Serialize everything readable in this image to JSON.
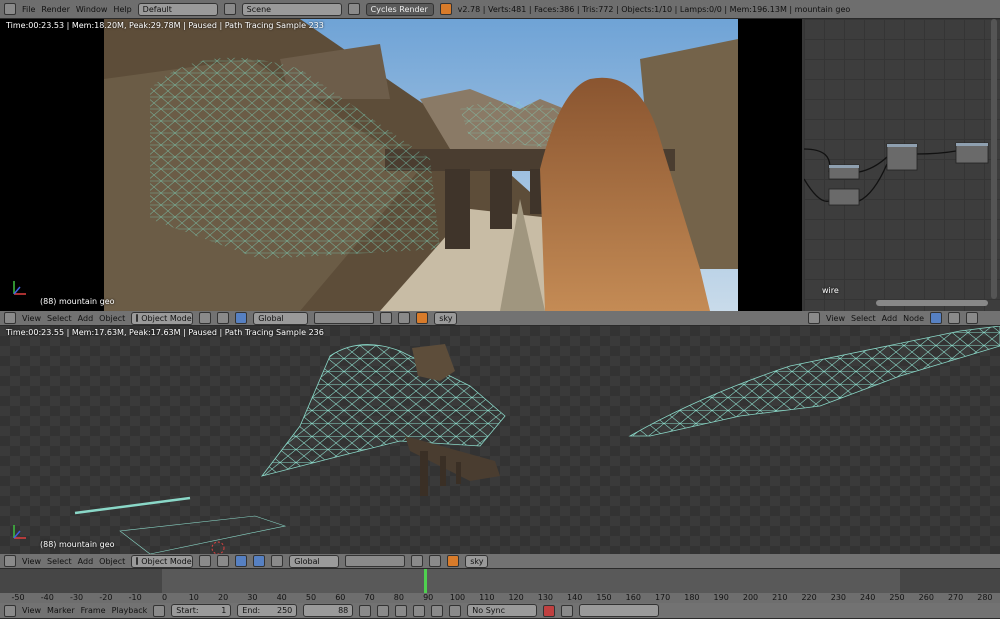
{
  "top_bar": {
    "menus": [
      "File",
      "Render",
      "Window",
      "Help"
    ],
    "layout": "Default",
    "scene": "Scene",
    "engine": "Cycles Render",
    "stats": "v2.78 | Verts:481 | Faces:386 | Tris:772 | Objects:1/10 | Lamps:0/0 | Mem:196.13M | mountain geo"
  },
  "render_view": {
    "status": "Time:00:23.53 | Mem:18.20M, Peak:29.78M | Paused | Path Tracing Sample 233",
    "object_label": "(88) mountain geo"
  },
  "header1": {
    "menus": [
      "View",
      "Select",
      "Add",
      "Object"
    ],
    "mode": "Object Mode",
    "orientation": "Global",
    "layer": "sky"
  },
  "node_editor": {
    "node_label": "wire",
    "menus": [
      "View",
      "Select",
      "Add",
      "Node"
    ]
  },
  "viewport": {
    "status": "Time:00:23.55 | Mem:17.63M, Peak:17.63M | Paused | Path Tracing Sample 236",
    "object_label": "(88) mountain geo"
  },
  "header2": {
    "menus": [
      "View",
      "Select",
      "Add",
      "Object"
    ],
    "mode": "Object Mode",
    "orientation": "Global",
    "layer": "sky"
  },
  "timeline": {
    "ticks": [
      "-50",
      "-40",
      "-30",
      "-20",
      "-10",
      "0",
      "10",
      "20",
      "30",
      "40",
      "50",
      "60",
      "70",
      "80",
      "90",
      "100",
      "110",
      "120",
      "130",
      "140",
      "150",
      "160",
      "170",
      "180",
      "190",
      "200",
      "210",
      "220",
      "230",
      "240",
      "250",
      "260",
      "270",
      "280"
    ],
    "current_frame": "88",
    "start_label": "Start:",
    "start": "1",
    "end_label": "End:",
    "end": "250",
    "sync": "No Sync",
    "menus": [
      "View",
      "Marker",
      "Frame",
      "Playback"
    ]
  }
}
